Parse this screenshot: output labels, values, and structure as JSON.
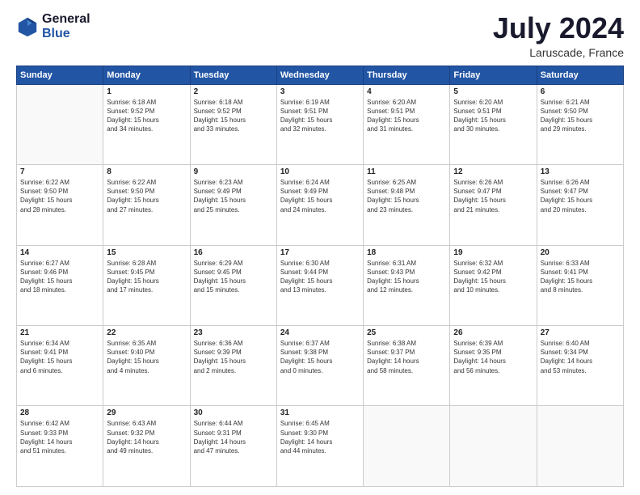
{
  "header": {
    "logo_line1": "General",
    "logo_line2": "Blue",
    "title": "July 2024",
    "subtitle": "Laruscade, France"
  },
  "weekdays": [
    "Sunday",
    "Monday",
    "Tuesday",
    "Wednesday",
    "Thursday",
    "Friday",
    "Saturday"
  ],
  "weeks": [
    [
      {
        "day": "",
        "info": ""
      },
      {
        "day": "1",
        "info": "Sunrise: 6:18 AM\nSunset: 9:52 PM\nDaylight: 15 hours\nand 34 minutes."
      },
      {
        "day": "2",
        "info": "Sunrise: 6:18 AM\nSunset: 9:52 PM\nDaylight: 15 hours\nand 33 minutes."
      },
      {
        "day": "3",
        "info": "Sunrise: 6:19 AM\nSunset: 9:51 PM\nDaylight: 15 hours\nand 32 minutes."
      },
      {
        "day": "4",
        "info": "Sunrise: 6:20 AM\nSunset: 9:51 PM\nDaylight: 15 hours\nand 31 minutes."
      },
      {
        "day": "5",
        "info": "Sunrise: 6:20 AM\nSunset: 9:51 PM\nDaylight: 15 hours\nand 30 minutes."
      },
      {
        "day": "6",
        "info": "Sunrise: 6:21 AM\nSunset: 9:50 PM\nDaylight: 15 hours\nand 29 minutes."
      }
    ],
    [
      {
        "day": "7",
        "info": "Sunrise: 6:22 AM\nSunset: 9:50 PM\nDaylight: 15 hours\nand 28 minutes."
      },
      {
        "day": "8",
        "info": "Sunrise: 6:22 AM\nSunset: 9:50 PM\nDaylight: 15 hours\nand 27 minutes."
      },
      {
        "day": "9",
        "info": "Sunrise: 6:23 AM\nSunset: 9:49 PM\nDaylight: 15 hours\nand 25 minutes."
      },
      {
        "day": "10",
        "info": "Sunrise: 6:24 AM\nSunset: 9:49 PM\nDaylight: 15 hours\nand 24 minutes."
      },
      {
        "day": "11",
        "info": "Sunrise: 6:25 AM\nSunset: 9:48 PM\nDaylight: 15 hours\nand 23 minutes."
      },
      {
        "day": "12",
        "info": "Sunrise: 6:26 AM\nSunset: 9:47 PM\nDaylight: 15 hours\nand 21 minutes."
      },
      {
        "day": "13",
        "info": "Sunrise: 6:26 AM\nSunset: 9:47 PM\nDaylight: 15 hours\nand 20 minutes."
      }
    ],
    [
      {
        "day": "14",
        "info": "Sunrise: 6:27 AM\nSunset: 9:46 PM\nDaylight: 15 hours\nand 18 minutes."
      },
      {
        "day": "15",
        "info": "Sunrise: 6:28 AM\nSunset: 9:45 PM\nDaylight: 15 hours\nand 17 minutes."
      },
      {
        "day": "16",
        "info": "Sunrise: 6:29 AM\nSunset: 9:45 PM\nDaylight: 15 hours\nand 15 minutes."
      },
      {
        "day": "17",
        "info": "Sunrise: 6:30 AM\nSunset: 9:44 PM\nDaylight: 15 hours\nand 13 minutes."
      },
      {
        "day": "18",
        "info": "Sunrise: 6:31 AM\nSunset: 9:43 PM\nDaylight: 15 hours\nand 12 minutes."
      },
      {
        "day": "19",
        "info": "Sunrise: 6:32 AM\nSunset: 9:42 PM\nDaylight: 15 hours\nand 10 minutes."
      },
      {
        "day": "20",
        "info": "Sunrise: 6:33 AM\nSunset: 9:41 PM\nDaylight: 15 hours\nand 8 minutes."
      }
    ],
    [
      {
        "day": "21",
        "info": "Sunrise: 6:34 AM\nSunset: 9:41 PM\nDaylight: 15 hours\nand 6 minutes."
      },
      {
        "day": "22",
        "info": "Sunrise: 6:35 AM\nSunset: 9:40 PM\nDaylight: 15 hours\nand 4 minutes."
      },
      {
        "day": "23",
        "info": "Sunrise: 6:36 AM\nSunset: 9:39 PM\nDaylight: 15 hours\nand 2 minutes."
      },
      {
        "day": "24",
        "info": "Sunrise: 6:37 AM\nSunset: 9:38 PM\nDaylight: 15 hours\nand 0 minutes."
      },
      {
        "day": "25",
        "info": "Sunrise: 6:38 AM\nSunset: 9:37 PM\nDaylight: 14 hours\nand 58 minutes."
      },
      {
        "day": "26",
        "info": "Sunrise: 6:39 AM\nSunset: 9:35 PM\nDaylight: 14 hours\nand 56 minutes."
      },
      {
        "day": "27",
        "info": "Sunrise: 6:40 AM\nSunset: 9:34 PM\nDaylight: 14 hours\nand 53 minutes."
      }
    ],
    [
      {
        "day": "28",
        "info": "Sunrise: 6:42 AM\nSunset: 9:33 PM\nDaylight: 14 hours\nand 51 minutes."
      },
      {
        "day": "29",
        "info": "Sunrise: 6:43 AM\nSunset: 9:32 PM\nDaylight: 14 hours\nand 49 minutes."
      },
      {
        "day": "30",
        "info": "Sunrise: 6:44 AM\nSunset: 9:31 PM\nDaylight: 14 hours\nand 47 minutes."
      },
      {
        "day": "31",
        "info": "Sunrise: 6:45 AM\nSunset: 9:30 PM\nDaylight: 14 hours\nand 44 minutes."
      },
      {
        "day": "",
        "info": ""
      },
      {
        "day": "",
        "info": ""
      },
      {
        "day": "",
        "info": ""
      }
    ]
  ]
}
